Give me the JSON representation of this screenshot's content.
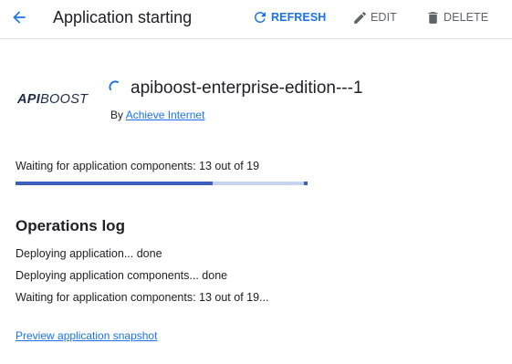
{
  "header": {
    "title": "Application starting",
    "actions": {
      "refresh": {
        "label": "REFRESH",
        "icon": "refresh-icon"
      },
      "edit": {
        "label": "EDIT",
        "icon": "pencil-icon"
      },
      "delete": {
        "label": "DELETE",
        "icon": "trash-icon"
      }
    }
  },
  "app": {
    "logo": {
      "part1": "API",
      "part2": "BOOST"
    },
    "name": "apiboost-enterprise-edition---1",
    "by_prefix": "By",
    "publisher": "Achieve Internet"
  },
  "progress": {
    "label": "Waiting for application components: 13 out of 19",
    "completed": 13,
    "total": 19
  },
  "operations_log": {
    "heading": "Operations log",
    "lines": [
      "Deploying application... done",
      "Deploying application components... done",
      "Waiting for application components: 13 out of 19..."
    ]
  },
  "preview_link": "Preview application snapshot",
  "colors": {
    "accent": "#1a73e8",
    "progress_fill": "#3b5fbf",
    "progress_track": "#c4d3ee",
    "muted": "#5f6368"
  }
}
